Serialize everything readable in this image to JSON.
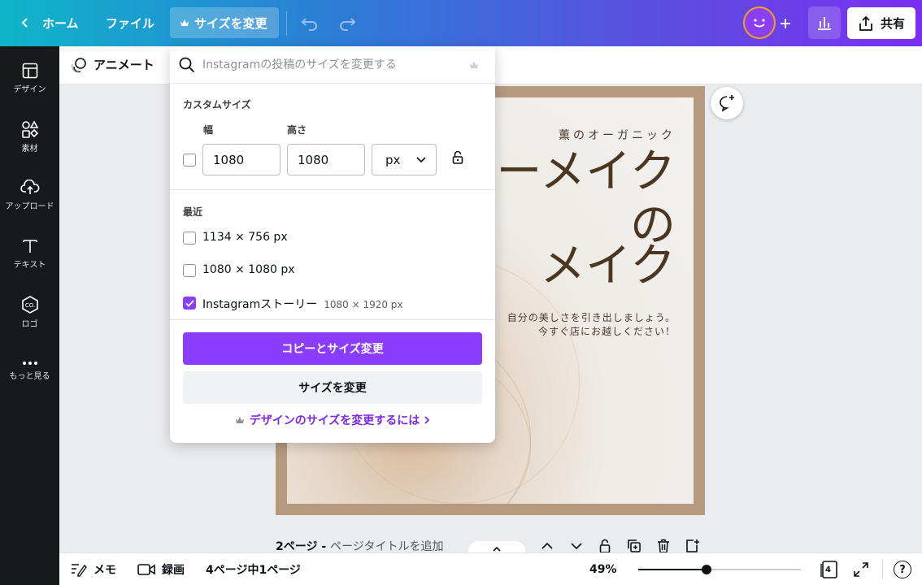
{
  "topbar": {
    "home_label": "ホーム",
    "file_label": "ファイル",
    "resize_label": "サイズを変更",
    "share_label": "共有"
  },
  "sidebar": {
    "items": [
      {
        "label": "デザイン",
        "icon": "layout-icon"
      },
      {
        "label": "素材",
        "icon": "elements-icon"
      },
      {
        "label": "アップロード",
        "icon": "upload-icon"
      },
      {
        "label": "テキスト",
        "icon": "text-icon"
      },
      {
        "label": "ロゴ",
        "icon": "logo-icon"
      },
      {
        "label": "もっと見る",
        "icon": "more-icon"
      }
    ]
  },
  "subbar": {
    "animate_label": "アニメート"
  },
  "popup": {
    "search_placeholder": "Instagramの投稿のサイズを変更する",
    "custom_size_title": "カスタムサイズ",
    "width_label": "幅",
    "height_label": "高さ",
    "width_value": "1080",
    "height_value": "1080",
    "unit_value": "px",
    "recent_title": "最近",
    "recent_items": [
      {
        "label": "1134 × 756 px",
        "sub": "",
        "checked": false
      },
      {
        "label": "1080 × 1080 px",
        "sub": "",
        "checked": false
      },
      {
        "label": "Instagramストーリー",
        "sub": "1080 × 1920 px",
        "checked": true
      }
    ],
    "copy_resize_label": "コピーとサイズ変更",
    "resize_label": "サイズを変更",
    "help_link": "デザインのサイズを変更するには"
  },
  "canvas": {
    "brand": "薫のオーガニック",
    "title_lines": [
      "ーメイク",
      "の",
      "メイク"
    ],
    "body_lines": [
      "自分の美しさを引き出しましょう。",
      "今すぐ店にお越しください！"
    ]
  },
  "page": {
    "number": "2ページ",
    "separator": " - ",
    "title_placeholder": "ページタイトルを追加"
  },
  "bottombar": {
    "notes_label": "メモ",
    "record_label": "録画",
    "page_count": "4ページ中1ページ",
    "zoom": "49%",
    "zoom_fraction": 0.42,
    "pages_badge": "4",
    "help": "?"
  },
  "colors": {
    "accent": "#8b3dff",
    "canvas_frame": "#b59a80",
    "title_text": "#4b3621"
  }
}
